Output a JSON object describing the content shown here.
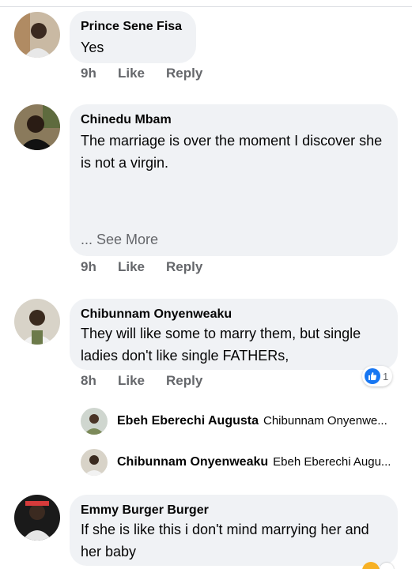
{
  "comments": [
    {
      "name": "Prince Sene Fisa",
      "text": "Yes",
      "time": "9h",
      "like": "Like",
      "reply": "Reply"
    },
    {
      "name": "Chinedu Mbam",
      "text": "The marriage is over the moment I discover she is not a virgin.",
      "see_more": "... See More",
      "time": "9h",
      "like": "Like",
      "reply": "Reply"
    },
    {
      "name": "Chibunnam Onyenweaku",
      "text": "They will like some to marry them, but single ladies don't like single FATHERs,",
      "time": "8h",
      "like": "Like",
      "reply": "Reply",
      "reaction": {
        "icon": "thumbs-up-icon",
        "count": "1"
      }
    },
    {
      "name": "Emmy Burger Burger",
      "text": "If she is like this i don't mind marrying her and her baby"
    }
  ],
  "replies": [
    {
      "name": "Ebeh Eberechi Augusta",
      "preview": "Chibunnam Onyenwe..."
    },
    {
      "name": "Chibunnam Onyenweaku",
      "preview": "Ebeh Eberechi Augu..."
    }
  ],
  "colors": {
    "bubble": "#f0f2f5",
    "meta": "#65676b",
    "accent": "#1877f2"
  }
}
